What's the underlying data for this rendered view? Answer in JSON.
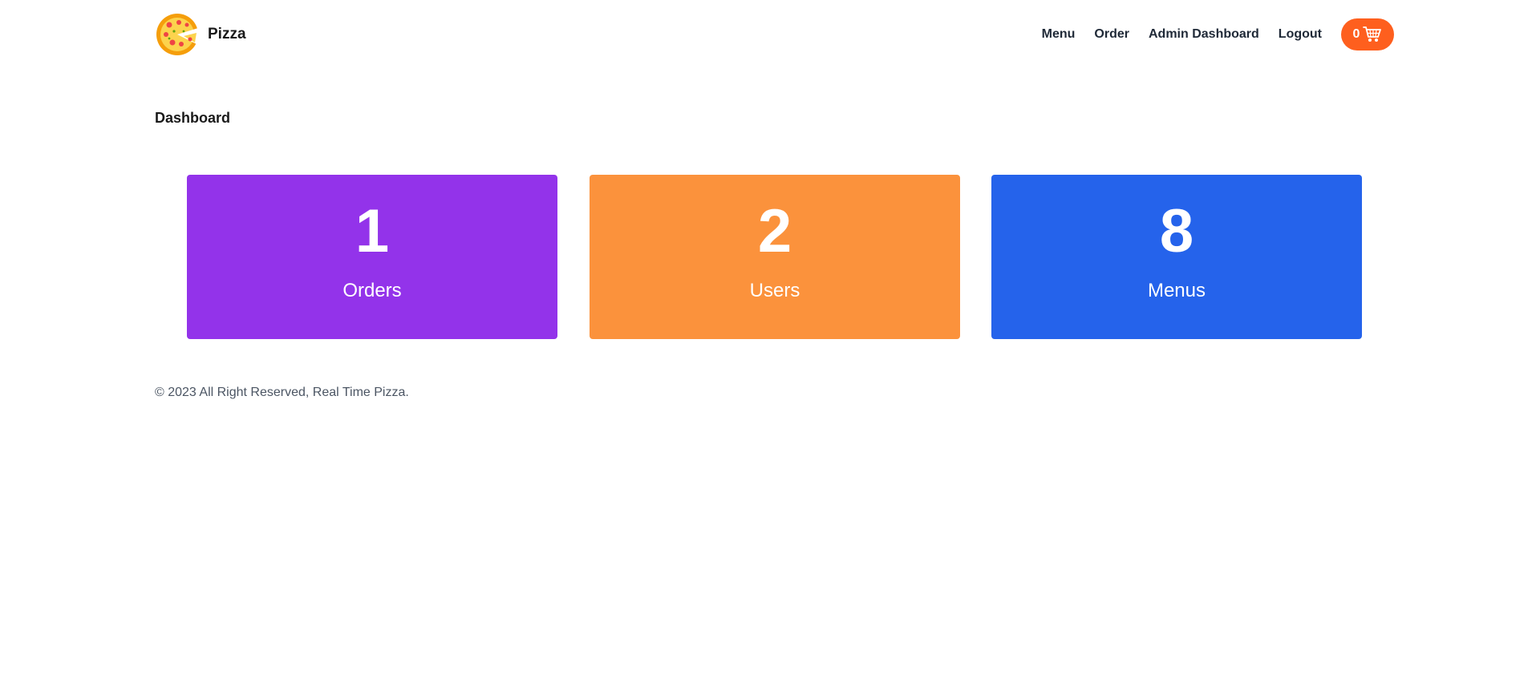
{
  "brand": {
    "name": "Pizza",
    "logo_icon": "pizza-icon"
  },
  "nav": {
    "items": [
      {
        "label": "Menu"
      },
      {
        "label": "Order"
      },
      {
        "label": "Admin Dashboard"
      },
      {
        "label": "Logout"
      }
    ],
    "cart": {
      "count": "0",
      "icon": "cart-icon",
      "color": "#fe5f1e"
    }
  },
  "page": {
    "title": "Dashboard"
  },
  "stats": [
    {
      "value": "1",
      "label": "Orders",
      "color": "#9333ea"
    },
    {
      "value": "2",
      "label": "Users",
      "color": "#fb923c"
    },
    {
      "value": "8",
      "label": "Menus",
      "color": "#2563eb"
    }
  ],
  "footer": {
    "text": "© 2023 All Right Reserved, Real Time Pizza."
  }
}
